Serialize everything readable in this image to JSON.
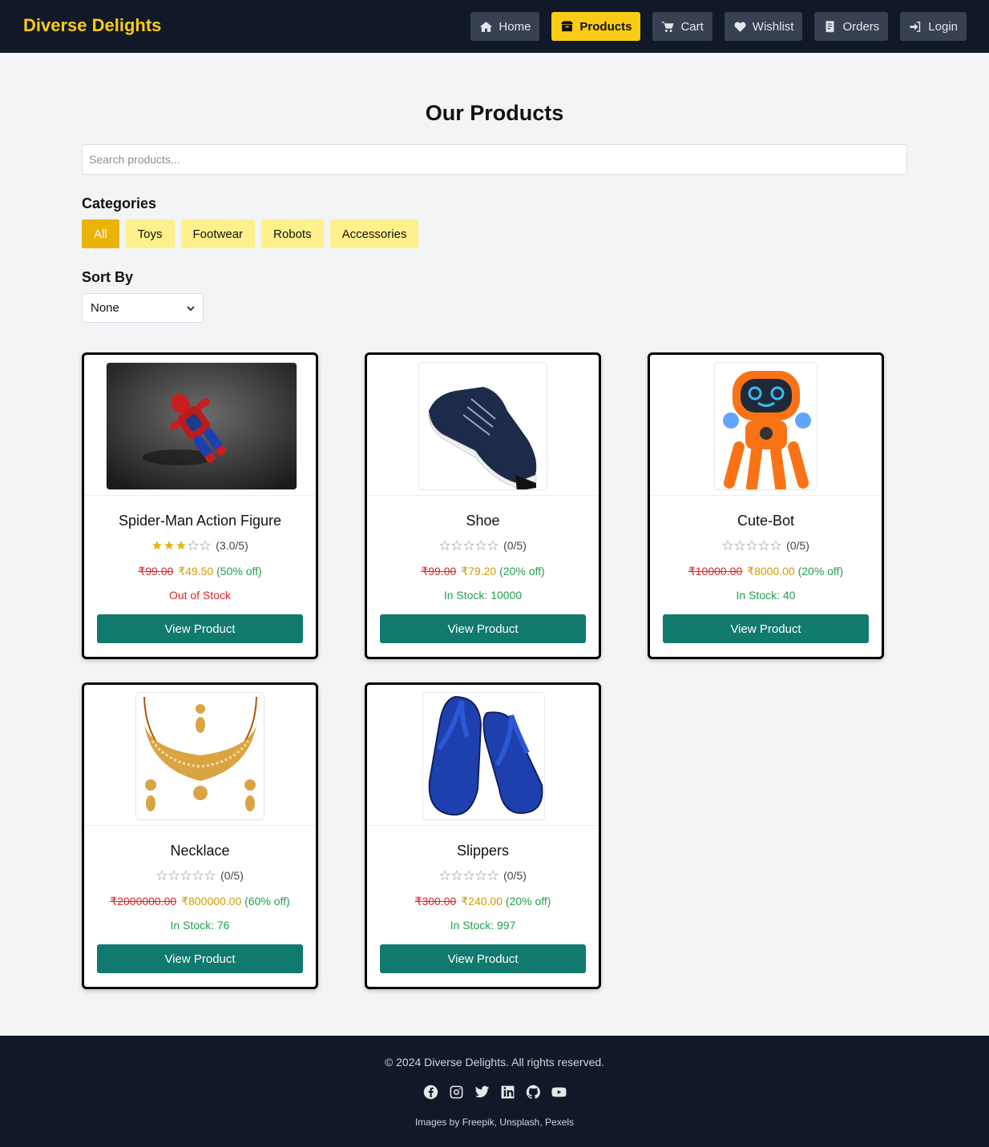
{
  "brand": "Diverse Delights",
  "nav": [
    {
      "label": "Home",
      "icon": "home-icon"
    },
    {
      "label": "Products",
      "icon": "box-icon",
      "active": true
    },
    {
      "label": "Cart",
      "icon": "cart-icon"
    },
    {
      "label": "Wishlist",
      "icon": "heart-icon"
    },
    {
      "label": "Orders",
      "icon": "receipt-icon"
    },
    {
      "label": "Login",
      "icon": "login-icon"
    }
  ],
  "page_title": "Our Products",
  "search": {
    "placeholder": "Search products..."
  },
  "categories": {
    "label": "Categories",
    "items": [
      "All",
      "Toys",
      "Footwear",
      "Robots",
      "Accessories"
    ],
    "selected": "All"
  },
  "sort": {
    "label": "Sort By",
    "selected": "None"
  },
  "products": [
    {
      "name": "Spider-Man Action Figure",
      "rating": 3,
      "rating_text": "(3.0/5)",
      "old_price": "₹99.00",
      "new_price": "₹49.50",
      "discount": "(50% off)",
      "stock": "Out of Stock",
      "in_stock": false,
      "button": "View Product"
    },
    {
      "name": "Shoe",
      "rating": 0,
      "rating_text": "(0/5)",
      "old_price": "₹99.00",
      "new_price": "₹79.20",
      "discount": "(20% off)",
      "stock": "In Stock: 10000",
      "in_stock": true,
      "button": "View Product"
    },
    {
      "name": "Cute-Bot",
      "rating": 0,
      "rating_text": "(0/5)",
      "old_price": "₹10000.00",
      "new_price": "₹8000.00",
      "discount": "(20% off)",
      "stock": "In Stock: 40",
      "in_stock": true,
      "button": "View Product"
    },
    {
      "name": "Necklace",
      "rating": 0,
      "rating_text": "(0/5)",
      "old_price": "₹2000000.00",
      "new_price": "₹800000.00",
      "discount": "(60% off)",
      "stock": "In Stock: 76",
      "in_stock": true,
      "button": "View Product"
    },
    {
      "name": "Slippers",
      "rating": 0,
      "rating_text": "(0/5)",
      "old_price": "₹300.00",
      "new_price": "₹240.00",
      "discount": "(20% off)",
      "stock": "In Stock: 997",
      "in_stock": true,
      "button": "View Product"
    }
  ],
  "footer": {
    "copyright": "© 2024 Diverse Delights. All rights reserved.",
    "socials": [
      "facebook-icon",
      "instagram-icon",
      "twitter-icon",
      "linkedin-icon",
      "github-icon",
      "youtube-icon"
    ],
    "credits": "Images by Freepik, Unsplash, Pexels"
  },
  "colors": {
    "brand": "#facc15",
    "nav_bg": "#111827",
    "button": "#117a6e",
    "star": "#eab308",
    "sale_price": "#d49b00",
    "discount": "#22a04b",
    "old_price": "#dc2626"
  }
}
